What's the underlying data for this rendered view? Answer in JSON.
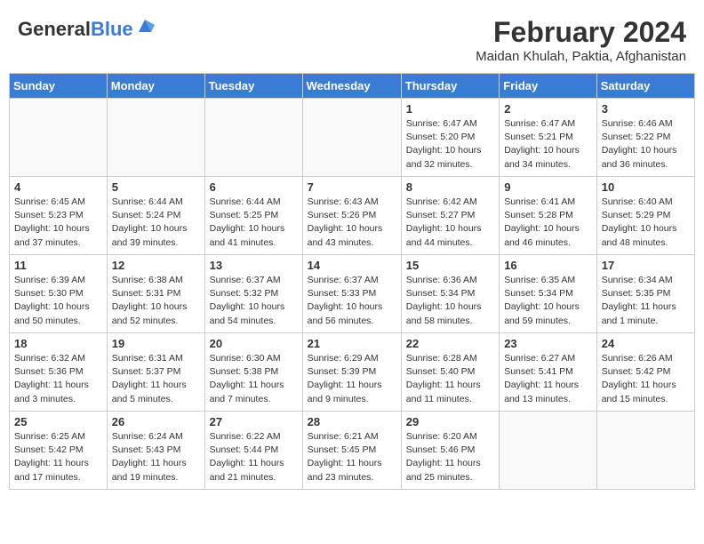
{
  "header": {
    "logo_general": "General",
    "logo_blue": "Blue",
    "month_year": "February 2024",
    "location": "Maidan Khulah, Paktia, Afghanistan"
  },
  "days_of_week": [
    "Sunday",
    "Monday",
    "Tuesday",
    "Wednesday",
    "Thursday",
    "Friday",
    "Saturday"
  ],
  "weeks": [
    [
      {
        "day": "",
        "info": ""
      },
      {
        "day": "",
        "info": ""
      },
      {
        "day": "",
        "info": ""
      },
      {
        "day": "",
        "info": ""
      },
      {
        "day": "1",
        "info": "Sunrise: 6:47 AM\nSunset: 5:20 PM\nDaylight: 10 hours\nand 32 minutes."
      },
      {
        "day": "2",
        "info": "Sunrise: 6:47 AM\nSunset: 5:21 PM\nDaylight: 10 hours\nand 34 minutes."
      },
      {
        "day": "3",
        "info": "Sunrise: 6:46 AM\nSunset: 5:22 PM\nDaylight: 10 hours\nand 36 minutes."
      }
    ],
    [
      {
        "day": "4",
        "info": "Sunrise: 6:45 AM\nSunset: 5:23 PM\nDaylight: 10 hours\nand 37 minutes."
      },
      {
        "day": "5",
        "info": "Sunrise: 6:44 AM\nSunset: 5:24 PM\nDaylight: 10 hours\nand 39 minutes."
      },
      {
        "day": "6",
        "info": "Sunrise: 6:44 AM\nSunset: 5:25 PM\nDaylight: 10 hours\nand 41 minutes."
      },
      {
        "day": "7",
        "info": "Sunrise: 6:43 AM\nSunset: 5:26 PM\nDaylight: 10 hours\nand 43 minutes."
      },
      {
        "day": "8",
        "info": "Sunrise: 6:42 AM\nSunset: 5:27 PM\nDaylight: 10 hours\nand 44 minutes."
      },
      {
        "day": "9",
        "info": "Sunrise: 6:41 AM\nSunset: 5:28 PM\nDaylight: 10 hours\nand 46 minutes."
      },
      {
        "day": "10",
        "info": "Sunrise: 6:40 AM\nSunset: 5:29 PM\nDaylight: 10 hours\nand 48 minutes."
      }
    ],
    [
      {
        "day": "11",
        "info": "Sunrise: 6:39 AM\nSunset: 5:30 PM\nDaylight: 10 hours\nand 50 minutes."
      },
      {
        "day": "12",
        "info": "Sunrise: 6:38 AM\nSunset: 5:31 PM\nDaylight: 10 hours\nand 52 minutes."
      },
      {
        "day": "13",
        "info": "Sunrise: 6:37 AM\nSunset: 5:32 PM\nDaylight: 10 hours\nand 54 minutes."
      },
      {
        "day": "14",
        "info": "Sunrise: 6:37 AM\nSunset: 5:33 PM\nDaylight: 10 hours\nand 56 minutes."
      },
      {
        "day": "15",
        "info": "Sunrise: 6:36 AM\nSunset: 5:34 PM\nDaylight: 10 hours\nand 58 minutes."
      },
      {
        "day": "16",
        "info": "Sunrise: 6:35 AM\nSunset: 5:34 PM\nDaylight: 10 hours\nand 59 minutes."
      },
      {
        "day": "17",
        "info": "Sunrise: 6:34 AM\nSunset: 5:35 PM\nDaylight: 11 hours\nand 1 minute."
      }
    ],
    [
      {
        "day": "18",
        "info": "Sunrise: 6:32 AM\nSunset: 5:36 PM\nDaylight: 11 hours\nand 3 minutes."
      },
      {
        "day": "19",
        "info": "Sunrise: 6:31 AM\nSunset: 5:37 PM\nDaylight: 11 hours\nand 5 minutes."
      },
      {
        "day": "20",
        "info": "Sunrise: 6:30 AM\nSunset: 5:38 PM\nDaylight: 11 hours\nand 7 minutes."
      },
      {
        "day": "21",
        "info": "Sunrise: 6:29 AM\nSunset: 5:39 PM\nDaylight: 11 hours\nand 9 minutes."
      },
      {
        "day": "22",
        "info": "Sunrise: 6:28 AM\nSunset: 5:40 PM\nDaylight: 11 hours\nand 11 minutes."
      },
      {
        "day": "23",
        "info": "Sunrise: 6:27 AM\nSunset: 5:41 PM\nDaylight: 11 hours\nand 13 minutes."
      },
      {
        "day": "24",
        "info": "Sunrise: 6:26 AM\nSunset: 5:42 PM\nDaylight: 11 hours\nand 15 minutes."
      }
    ],
    [
      {
        "day": "25",
        "info": "Sunrise: 6:25 AM\nSunset: 5:42 PM\nDaylight: 11 hours\nand 17 minutes."
      },
      {
        "day": "26",
        "info": "Sunrise: 6:24 AM\nSunset: 5:43 PM\nDaylight: 11 hours\nand 19 minutes."
      },
      {
        "day": "27",
        "info": "Sunrise: 6:22 AM\nSunset: 5:44 PM\nDaylight: 11 hours\nand 21 minutes."
      },
      {
        "day": "28",
        "info": "Sunrise: 6:21 AM\nSunset: 5:45 PM\nDaylight: 11 hours\nand 23 minutes."
      },
      {
        "day": "29",
        "info": "Sunrise: 6:20 AM\nSunset: 5:46 PM\nDaylight: 11 hours\nand 25 minutes."
      },
      {
        "day": "",
        "info": ""
      },
      {
        "day": "",
        "info": ""
      }
    ]
  ]
}
